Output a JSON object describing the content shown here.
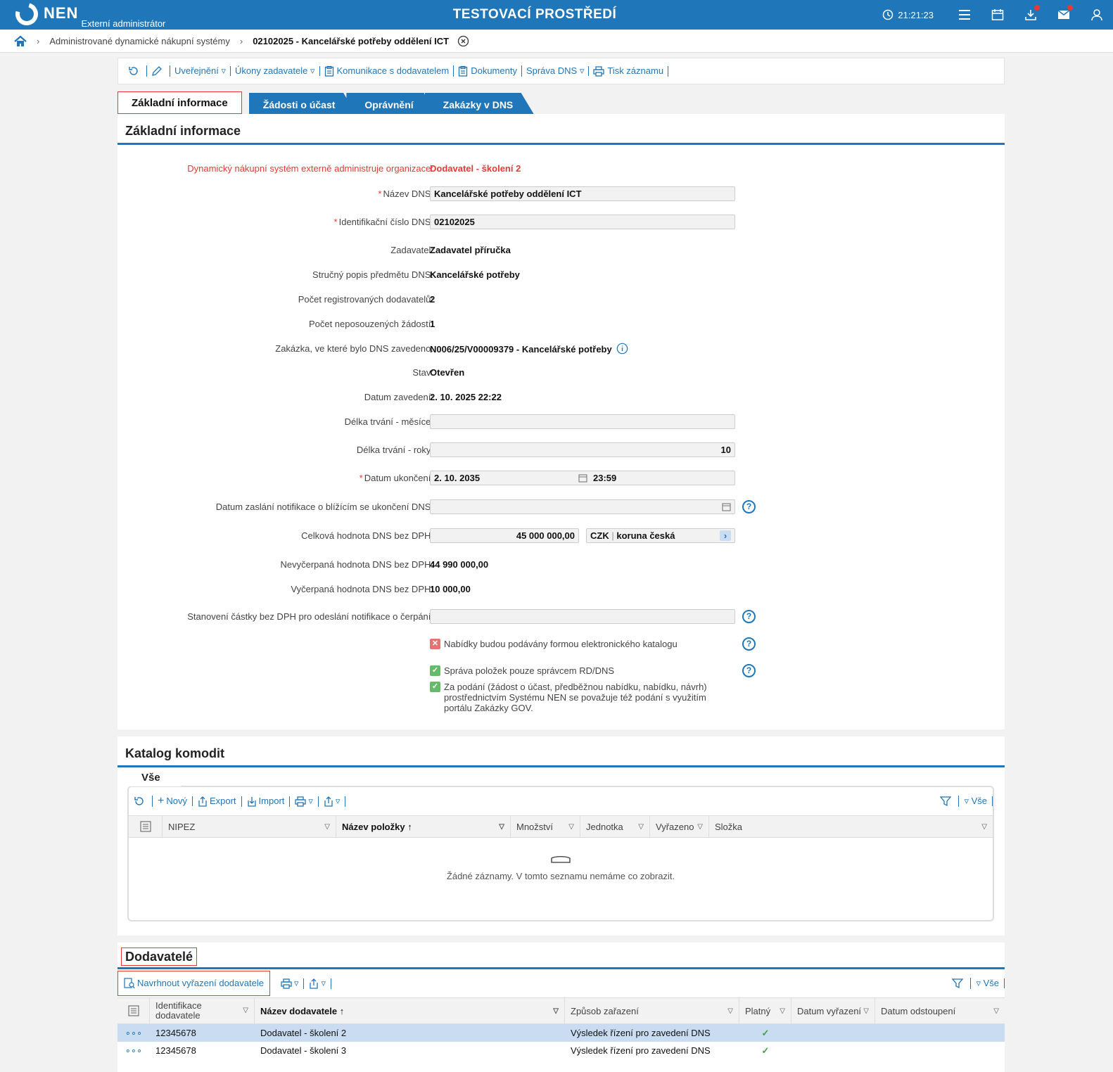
{
  "header": {
    "logo_text": "NEN",
    "logo_sub": "Externí administrátor",
    "env_title": "TESTOVACÍ PROSTŘEDÍ",
    "clock": "21:21:23"
  },
  "breadcrumb": {
    "item1": "Administrované dynamické nákupní systémy",
    "current": "02102025 - Kancelářské potřeby oddělení ICT"
  },
  "toolbar": {
    "publish": "Uveřejnění",
    "actions": "Úkony zadavatele",
    "comm": "Komunikace s dodavatelem",
    "docs": "Dokumenty",
    "dns": "Správa DNS",
    "print": "Tisk záznamu"
  },
  "tabs": {
    "t1": "Základní informace",
    "t2": "Žádosti o účast",
    "t3": "Oprávnění",
    "t4": "Zakázky v DNS"
  },
  "basic": {
    "title": "Základní informace",
    "admin_label": "Dynamický nákupní systém externě administruje organizace:",
    "admin_value": "Dodavatel - školení 2",
    "name_label": "Název DNS:",
    "name_value": "Kancelářské potřeby oddělení ICT",
    "id_label": "Identifikační číslo DNS:",
    "id_value": "02102025",
    "contr_label": "Zadavatel:",
    "contr_value": "Zadavatel příručka",
    "desc_label": "Stručný popis předmětu DNS:",
    "desc_value": "Kancelářské potřeby",
    "reg_label": "Počet registrovaných dodavatelů:",
    "reg_value": "2",
    "unrev_label": "Počet neposouzených žádostí:",
    "unrev_value": "1",
    "order_label": "Zakázka, ve které bylo DNS zavedeno:",
    "order_value": "N006/25/V00009379 - Kancelářské potřeby",
    "state_label": "Stav:",
    "state_value": "Otevřen",
    "date_label": "Datum zavedení:",
    "date_value": "2. 10. 2025 22:22",
    "months_label": "Délka trvání - měsíce:",
    "months_value": "",
    "years_label": "Délka trvání - roky:",
    "years_value": "10",
    "end_label": "Datum ukončení:",
    "end_date": "2. 10. 2035",
    "end_time": "23:59",
    "notif_label": "Datum zaslání notifikace o blížícím se ukončení DNS:",
    "total_label": "Celková hodnota DNS bez DPH:",
    "total_value": "45 000 000,00",
    "currency_code": "CZK",
    "currency_name": "koruna česká",
    "unused_label": "Nevyčerpaná hodnota DNS bez DPH:",
    "unused_value": "44 990 000,00",
    "used_label": "Vyčerpaná hodnota DNS bez DPH:",
    "used_value": "10 000,00",
    "limit_label": "Stanovení částky bez DPH pro odeslání notifikace o čerpání:",
    "chk1": "Nabídky budou podávány formou elektronického katalogu",
    "chk2": "Správa položek pouze správcem RD/DNS",
    "chk3": "Za podání (žádost o účast, předběžnou nabídku, nabídku, návrh) prostřednictvím Systému NEN se považuje též podání s využitím portálu Zakázky GOV."
  },
  "catalog": {
    "title": "Katalog komodit",
    "tab": "Vše",
    "tb": {
      "new": "Nový",
      "export": "Export",
      "import": "Import",
      "all": "Vše"
    },
    "cols": [
      "NIPEZ",
      "Název položky",
      "Množství",
      "Jednotka",
      "Vyřazeno",
      "Složka"
    ],
    "empty": "Žádné záznamy. V tomto seznamu nemáme co zobrazit."
  },
  "suppliers": {
    "title": "Dodavatelé",
    "propose": "Navrhnout vyřazení dodavatele",
    "all": "Vše",
    "cols": [
      "Identifikace dodavatele",
      "Název dodavatele",
      "Způsob zařazení",
      "Platný",
      "Datum vyřazení",
      "Datum odstoupení"
    ],
    "rows": [
      {
        "id": "12345678",
        "name": "Dodavatel - školení 2",
        "mode": "Výsledek řízení pro zavedení DNS"
      },
      {
        "id": "12345678",
        "name": "Dodavatel - školení 3",
        "mode": "Výsledek řízení pro zavedení DNS"
      }
    ]
  }
}
